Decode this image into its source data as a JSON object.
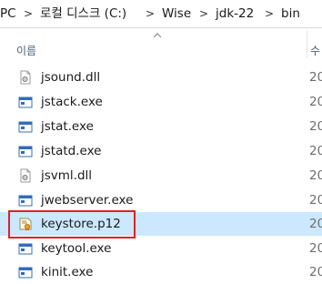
{
  "breadcrumb": {
    "items": [
      "PC",
      "로컬 디스크 (C:)",
      "Wise",
      "jdk-22",
      "bin"
    ],
    "separator": ">"
  },
  "columns": {
    "name": "이름",
    "next": "수"
  },
  "files": [
    {
      "name": "jsound.dll",
      "type": "dll",
      "date": "20"
    },
    {
      "name": "jstack.exe",
      "type": "exe",
      "date": "20"
    },
    {
      "name": "jstat.exe",
      "type": "exe",
      "date": "20"
    },
    {
      "name": "jstatd.exe",
      "type": "exe",
      "date": "20"
    },
    {
      "name": "jsvml.dll",
      "type": "dll",
      "date": "20"
    },
    {
      "name": "jwebserver.exe",
      "type": "exe",
      "date": "20"
    },
    {
      "name": "keystore.p12",
      "type": "cert",
      "date": "20",
      "selected": true
    },
    {
      "name": "keytool.exe",
      "type": "exe",
      "date": "20"
    },
    {
      "name": "kinit.exe",
      "type": "exe",
      "date": "20"
    }
  ],
  "colors": {
    "selection": "#cce8ff",
    "highlight": "#e0202a"
  }
}
